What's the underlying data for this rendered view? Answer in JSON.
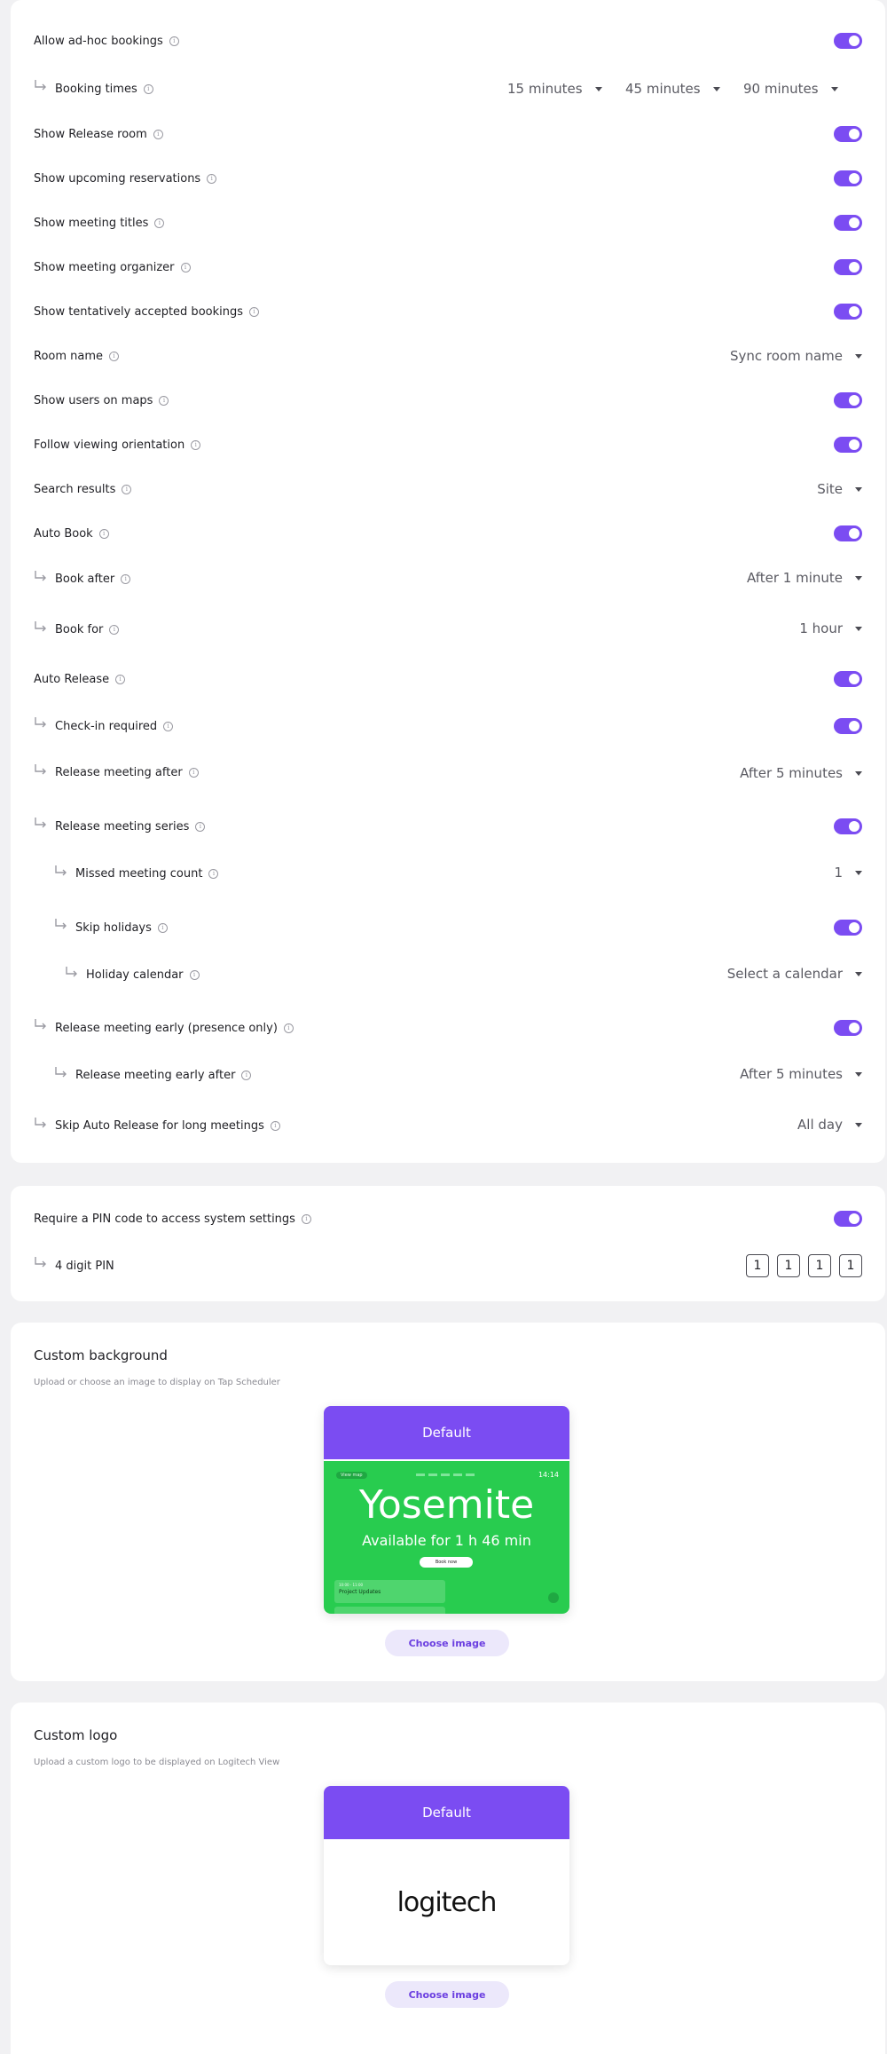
{
  "colors": {
    "accent": "#7b4cf2",
    "yosemite_green": "#28cc4f",
    "page_bg": "#f1f1f3"
  },
  "settings": {
    "allow_adhoc": {
      "label": "Allow ad-hoc bookings",
      "enabled": true
    },
    "booking_times": {
      "label": "Booking times",
      "options": [
        "15 minutes",
        "45 minutes",
        "90 minutes"
      ]
    },
    "show_release_room": {
      "label": "Show Release room",
      "enabled": true
    },
    "show_upcoming": {
      "label": "Show upcoming reservations",
      "enabled": true
    },
    "show_titles": {
      "label": "Show meeting titles",
      "enabled": true
    },
    "show_organizer": {
      "label": "Show meeting organizer",
      "enabled": true
    },
    "show_tentative": {
      "label": "Show tentatively accepted bookings",
      "enabled": true
    },
    "room_name": {
      "label": "Room name",
      "value": "Sync room name"
    },
    "show_users_maps": {
      "label": "Show users on maps",
      "enabled": true
    },
    "follow_orientation": {
      "label": "Follow viewing orientation",
      "enabled": true
    },
    "search_results": {
      "label": "Search results",
      "value": "Site"
    },
    "auto_book": {
      "label": "Auto Book",
      "enabled": true
    },
    "book_after": {
      "label": "Book after",
      "value": "After 1 minute"
    },
    "book_for": {
      "label": "Book for",
      "value": "1 hour"
    },
    "auto_release": {
      "label": "Auto Release",
      "enabled": true
    },
    "checkin_required": {
      "label": "Check-in required",
      "enabled": true
    },
    "release_after": {
      "label": "Release meeting after",
      "value": "After 5 minutes"
    },
    "release_series": {
      "label": "Release meeting series",
      "enabled": true
    },
    "missed_count": {
      "label": "Missed meeting count",
      "value": "1"
    },
    "skip_holidays": {
      "label": "Skip holidays",
      "enabled": true
    },
    "holiday_calendar": {
      "label": "Holiday calendar",
      "value": "Select a calendar"
    },
    "release_early": {
      "label": "Release meeting early (presence only)",
      "enabled": true
    },
    "release_early_after": {
      "label": "Release meeting early after",
      "value": "After 5 minutes"
    },
    "skip_long": {
      "label": "Skip Auto Release for long meetings",
      "value": "All day"
    }
  },
  "pin": {
    "require_label": "Require a PIN code to access system settings",
    "require_enabled": true,
    "digits_label": "4 digit PIN",
    "digits": [
      "1",
      "1",
      "1",
      "1"
    ]
  },
  "custom_background": {
    "title": "Custom background",
    "description": "Upload or choose an image to display on Tap Scheduler",
    "default_label": "Default",
    "preview": {
      "chip": "View map",
      "time": "14:14",
      "room": "Yosemite",
      "status": "Available for 1 h 46 min",
      "book_button": "Book now",
      "card_meta": "10:00 - 11:00",
      "card_title": "Project Updates"
    },
    "choose_label": "Choose image"
  },
  "custom_logo": {
    "title": "Custom logo",
    "description": "Upload a custom logo to be displayed on Logitech View",
    "default_label": "Default",
    "logo_text": "logitech",
    "choose_label": "Choose image"
  }
}
